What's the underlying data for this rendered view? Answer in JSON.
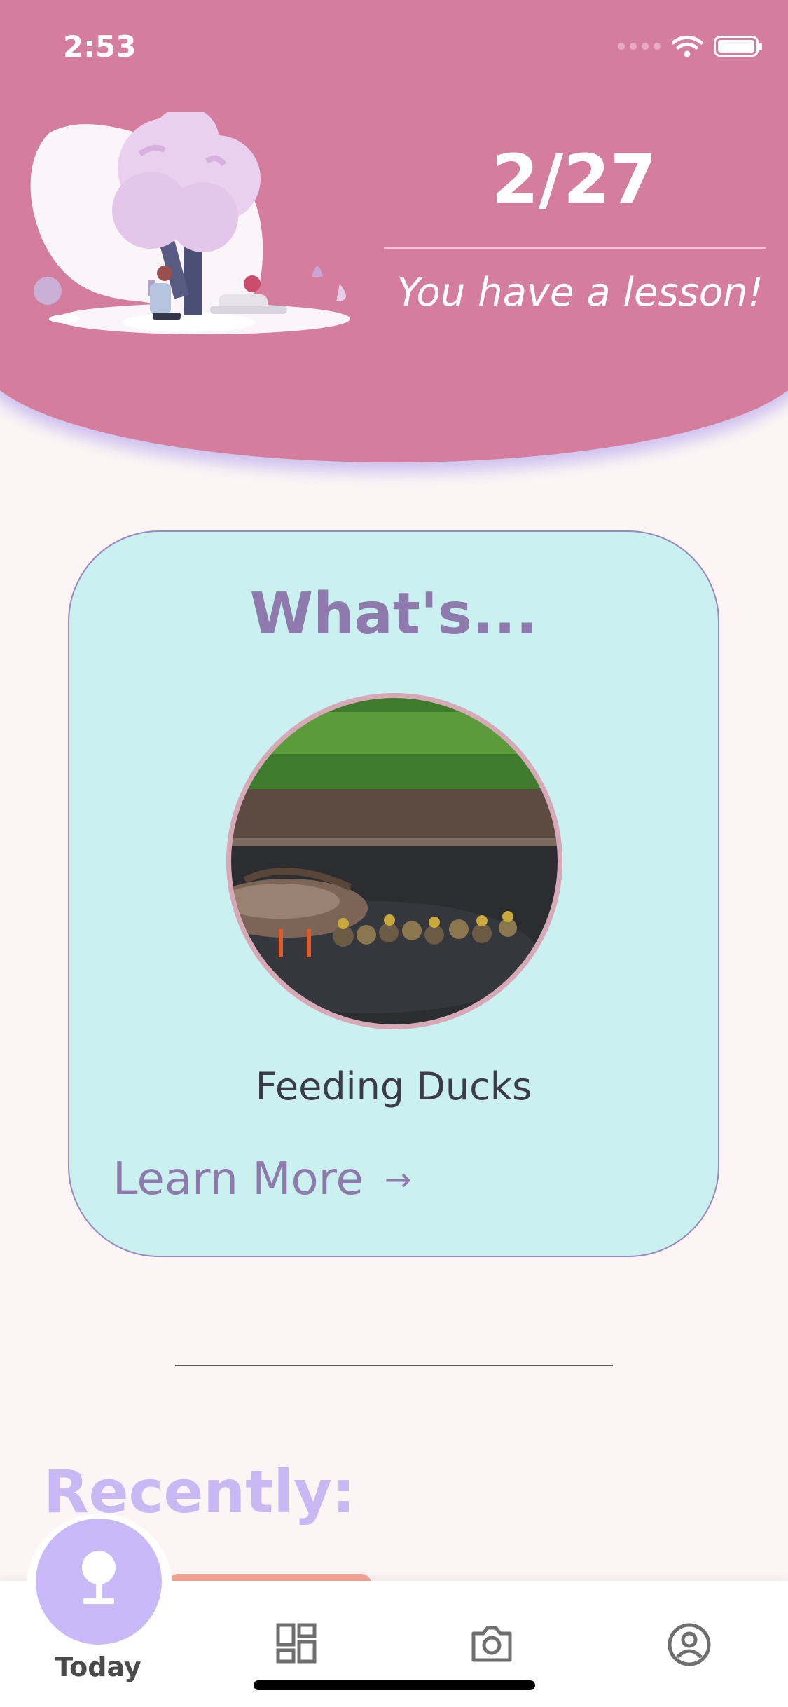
{
  "status_bar": {
    "time": "2:53"
  },
  "header": {
    "date": "2/27",
    "subtitle": "You have a lesson!"
  },
  "card": {
    "title": "What's...",
    "lesson_name": "Feeding Ducks",
    "learn_more_label": "Learn More",
    "arrow": "→"
  },
  "recently": {
    "heading": "Recently:"
  },
  "tabbar": {
    "tabs": [
      {
        "label": "Today",
        "icon": "tree-icon"
      },
      {
        "icon": "dashboard-icon"
      },
      {
        "icon": "camera-icon"
      },
      {
        "icon": "account-icon"
      }
    ]
  },
  "colors": {
    "header": "#d57d9c",
    "background": "#fdf5f5",
    "card": "#cbf0f0",
    "accent": "#8e7aad",
    "fab": "#cab9f8",
    "recently": "#cab8f5"
  }
}
